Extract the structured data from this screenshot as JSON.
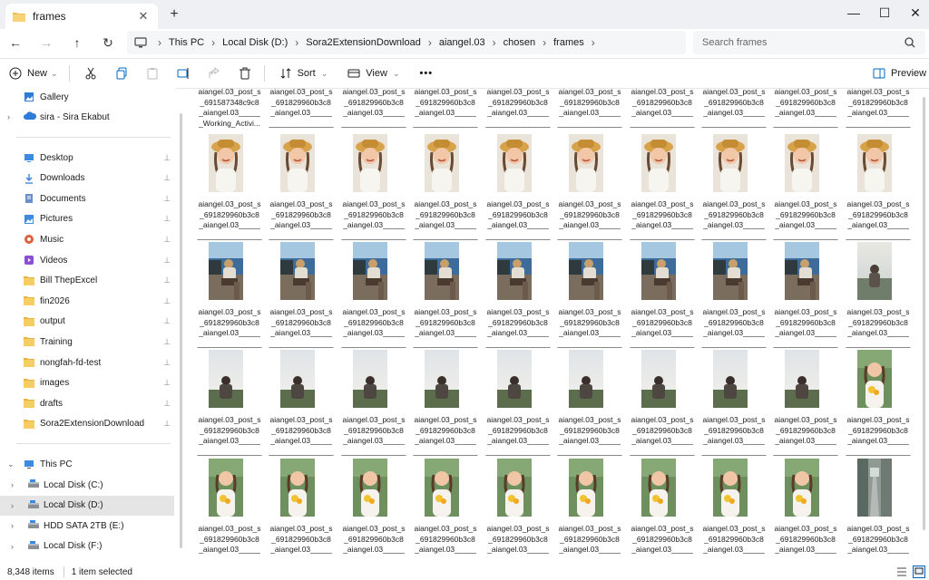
{
  "window": {
    "tab_title": "frames",
    "tab_close": "✕",
    "new_tab": "+",
    "minimize": "—",
    "maximize": "☐",
    "close": "✕"
  },
  "address": {
    "crumbs": [
      "This PC",
      "Local Disk (D:)",
      "Sora2ExtensionDownload",
      "aiangel.03",
      "chosen",
      "frames"
    ],
    "search_placeholder": "Search frames"
  },
  "toolbar": {
    "new_label": "New",
    "sort_label": "Sort",
    "view_label": "View",
    "more_label": "•••",
    "preview_label": "Preview"
  },
  "sidebar": {
    "top": [
      {
        "label": "Gallery",
        "icon": "gallery-icon",
        "chev": ""
      },
      {
        "label": "sira - Sira Ekabut",
        "icon": "cloud-icon",
        "chev": "›"
      }
    ],
    "quick": [
      {
        "label": "Desktop",
        "icon": "desktop-icon"
      },
      {
        "label": "Downloads",
        "icon": "download-icon"
      },
      {
        "label": "Documents",
        "icon": "documents-icon"
      },
      {
        "label": "Pictures",
        "icon": "pictures-icon"
      },
      {
        "label": "Music",
        "icon": "music-icon"
      },
      {
        "label": "Videos",
        "icon": "videos-icon"
      },
      {
        "label": "Bill ThepExcel",
        "icon": "folder-icon"
      },
      {
        "label": "fin2026",
        "icon": "folder-icon"
      },
      {
        "label": "output",
        "icon": "folder-icon"
      },
      {
        "label": "Training",
        "icon": "folder-icon"
      },
      {
        "label": "nongfah-fd-test",
        "icon": "folder-icon"
      },
      {
        "label": "images",
        "icon": "folder-icon"
      },
      {
        "label": "drafts",
        "icon": "folder-icon"
      },
      {
        "label": "Sora2ExtensionDownload",
        "icon": "folder-icon"
      }
    ],
    "pin_glyph": "📌",
    "this_pc": "This PC",
    "drives": [
      {
        "label": "Local Disk (C:)",
        "selected": false
      },
      {
        "label": "Local Disk (D:)",
        "selected": true
      },
      {
        "label": "HDD SATA 2TB (E:)",
        "selected": false
      },
      {
        "label": "Local Disk (F:)",
        "selected": false
      }
    ]
  },
  "files": {
    "first_row_names": [
      "aiangel.03_post_s\n_691587348c9c8\n_aiangel.03_____\n_Working_Activi...",
      "aiangel.03_post_s\n_691829960b3c8\n_aiangel.03_____\n_______________",
      "aiangel.03_post_s\n_691829960b3c8\n_aiangel.03_____\n_______________",
      "aiangel.03_post_s\n_691829960b3c8\n_aiangel.03_____\n_______________",
      "aiangel.03_post_s\n_691829960b3c8\n_aiangel.03_____\n_______________",
      "aiangel.03_post_s\n_691829960b3c8\n_aiangel.03_____\n_______________",
      "aiangel.03_post_s\n_691829960b3c8\n_aiangel.03_____\n_______________",
      "aiangel.03_post_s\n_691829960b3c8\n_aiangel.03_____\n_______________",
      "aiangel.03_post_s\n_691829960b3c8\n_aiangel.03_____\n_______________",
      "aiangel.03_post_s\n_691829960b3c8\n_aiangel.03_____\n_______________"
    ],
    "name": "aiangel.03_post_s\n_691829960b3c8\n_aiangel.03_____\n_______________",
    "rows": [
      [
        "hat",
        "hat",
        "hat",
        "hat",
        "hat",
        "hat",
        "hat",
        "hat",
        "hat",
        "hat"
      ],
      [
        "sit",
        "sit",
        "sit",
        "sit",
        "sit",
        "sit",
        "sit",
        "sit",
        "sit",
        "stand"
      ],
      [
        "sky",
        "sky",
        "sky",
        "sky",
        "sky",
        "sky",
        "sky",
        "sky",
        "sky",
        "flower"
      ],
      [
        "flower",
        "flower",
        "flower",
        "flower",
        "flower",
        "flower",
        "flower",
        "flower",
        "flower",
        "street"
      ]
    ]
  },
  "status": {
    "count": "8,348 items",
    "selected": "1 item selected"
  },
  "colors": {
    "accent": "#0067c0",
    "folder": "#f2c14e",
    "selected_bg": "#e5e5e5"
  }
}
